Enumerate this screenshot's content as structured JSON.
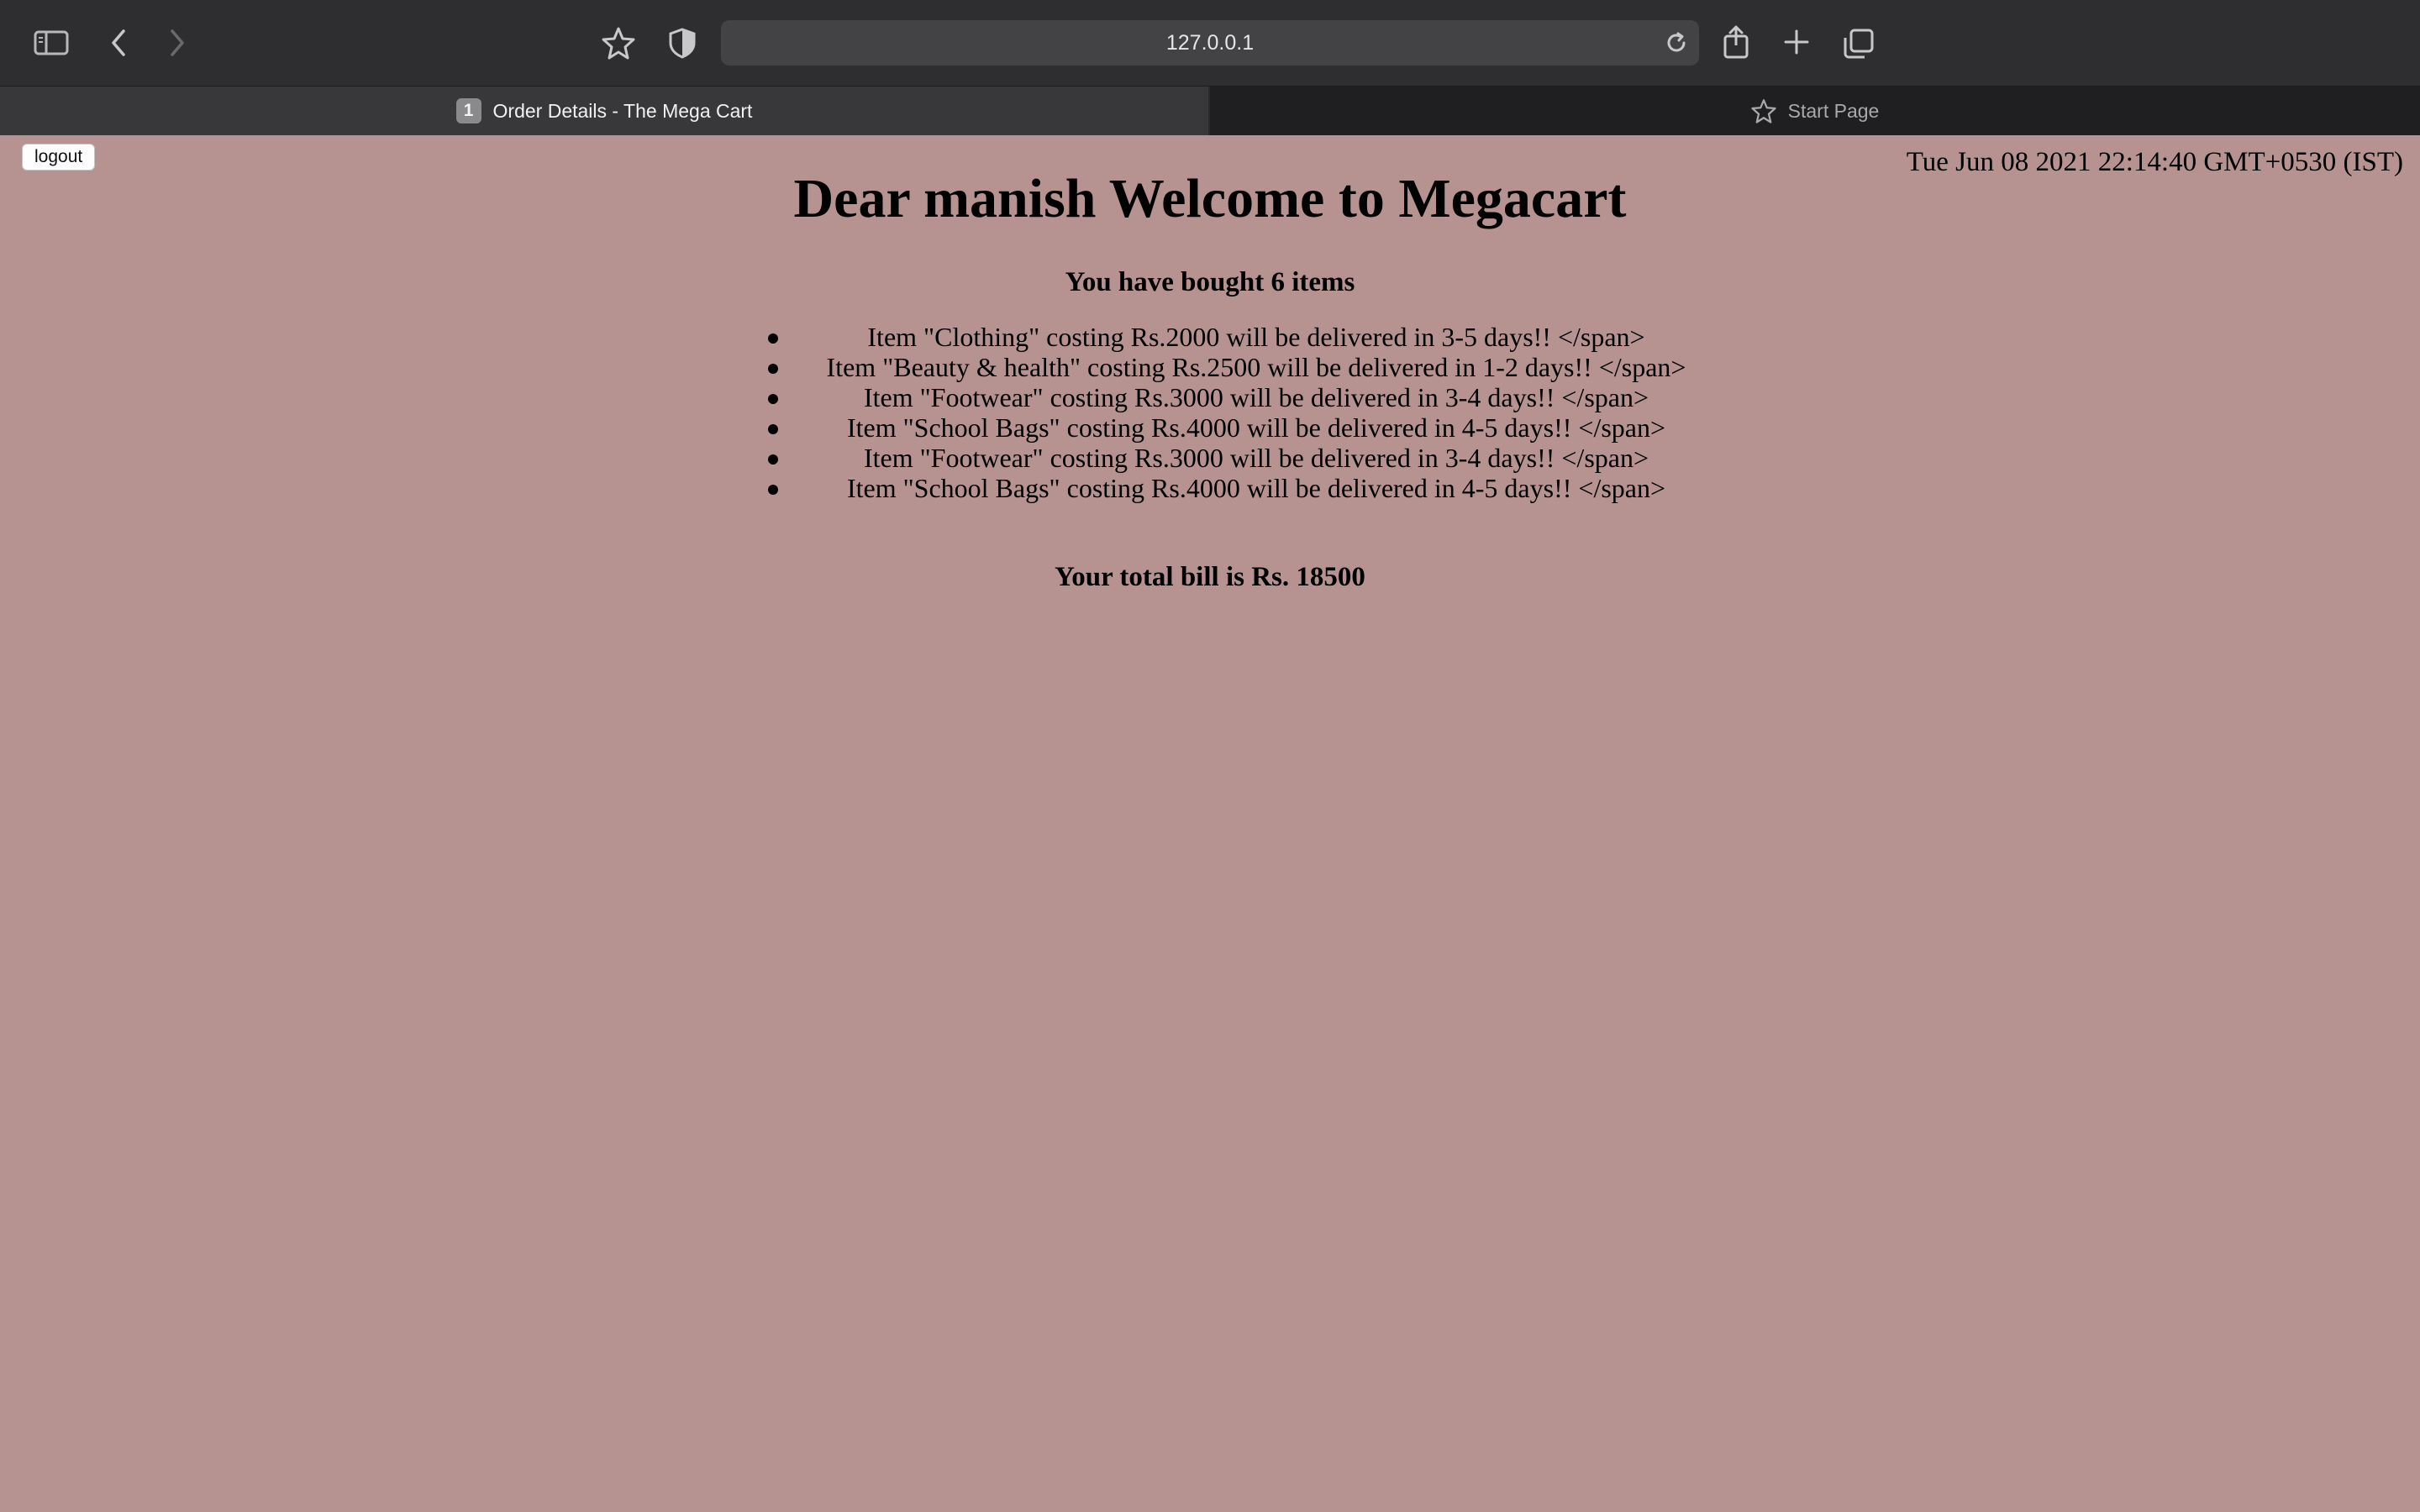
{
  "browser": {
    "url": "127.0.0.1",
    "tabs": [
      {
        "label": "Order Details - The Mega Cart",
        "badge": "1",
        "active": true
      },
      {
        "label": "Start Page",
        "active": false
      }
    ]
  },
  "page": {
    "logout_label": "logout",
    "datetime": "Tue Jun 08 2021 22:14:40 GMT+0530 (IST)",
    "title": "Dear manish Welcome to Megacart",
    "subtitle": "You have bought 6 items",
    "items": [
      "Item \"Clothing\" costing Rs.2000 will be delivered in 3-5 days!! </span>",
      "Item \"Beauty & health\" costing Rs.2500 will be delivered in 1-2 days!! </span>",
      "Item \"Footwear\" costing Rs.3000 will be delivered in 3-4 days!! </span>",
      "Item \"School Bags\" costing Rs.4000 will be delivered in 4-5 days!! </span>",
      "Item \"Footwear\" costing Rs.3000 will be delivered in 3-4 days!! </span>",
      "Item \"School Bags\" costing Rs.4000 will be delivered in 4-5 days!! </span>"
    ],
    "total": "Your total bill is Rs. 18500"
  },
  "colors": {
    "page_background": "#b69391",
    "toolbar": "#2e2d2f",
    "tabbar": "#1f1e20"
  }
}
